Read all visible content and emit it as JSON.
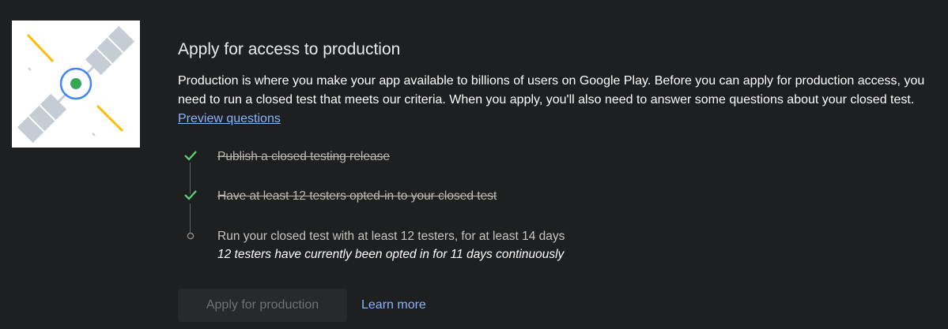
{
  "illustration": {
    "icon": "satellite-illustration",
    "colors": {
      "panel": "#c5ccd3",
      "ring": "#4285f4",
      "core": "#34a853",
      "beam": "#fbbc04"
    }
  },
  "section": {
    "title": "Apply for access to production",
    "description": "Production is where you make your app available to billions of users on Google Play. Before you can apply for production access, you need to run a closed test that meets our criteria. When you apply, you'll also need to answer some questions about your closed test.",
    "preview_link": "Preview questions"
  },
  "steps": [
    {
      "label": "Publish a closed testing release",
      "status": "complete",
      "icon": "check-icon"
    },
    {
      "label": "Have at least 12 testers opted-in to your closed test",
      "status": "complete",
      "icon": "check-icon"
    },
    {
      "label": "Run your closed test with at least 12 testers, for at least 14 days",
      "detail": "12 testers have currently been opted in for 11 days continuously",
      "status": "pending",
      "icon": "circle-outline-icon"
    }
  ],
  "actions": {
    "apply_label": "Apply for production",
    "learn_more_label": "Learn more"
  },
  "colors": {
    "background": "#1e1f21",
    "link": "#8ab4f8",
    "check": "#5bd47a"
  }
}
